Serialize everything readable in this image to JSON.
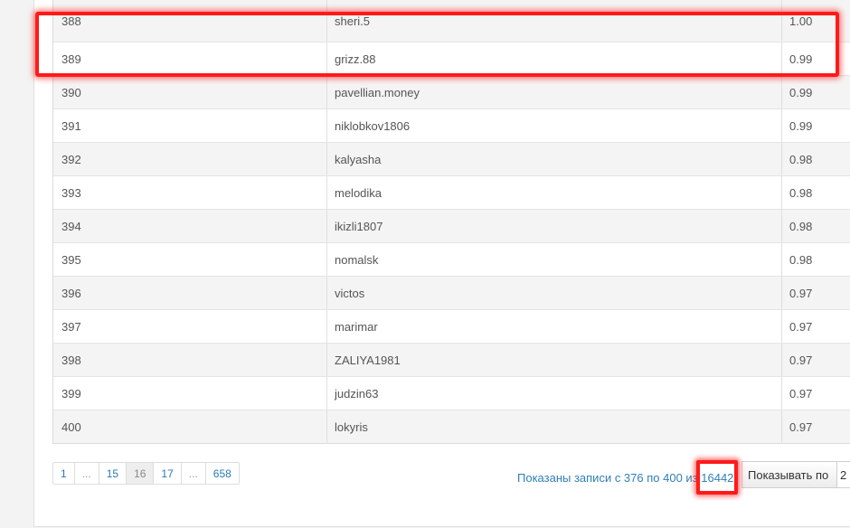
{
  "table": {
    "rows": [
      {
        "num": "388",
        "name": "sheri.5",
        "value": "1.00"
      },
      {
        "num": "389",
        "name": "grizz.88",
        "value": "0.99"
      },
      {
        "num": "390",
        "name": "pavellian.money",
        "value": "0.99"
      },
      {
        "num": "391",
        "name": "niklobkov1806",
        "value": "0.99"
      },
      {
        "num": "392",
        "name": "kalyasha",
        "value": "0.98"
      },
      {
        "num": "393",
        "name": "melodika",
        "value": "0.98"
      },
      {
        "num": "394",
        "name": "ikizli1807",
        "value": "0.98"
      },
      {
        "num": "395",
        "name": "nomalsk",
        "value": "0.98"
      },
      {
        "num": "396",
        "name": "victos",
        "value": "0.97"
      },
      {
        "num": "397",
        "name": "marimar",
        "value": "0.97"
      },
      {
        "num": "398",
        "name": "ZALIYA1981",
        "value": "0.97"
      },
      {
        "num": "399",
        "name": "judzin63",
        "value": "0.97"
      },
      {
        "num": "400",
        "name": "lokyris",
        "value": "0.97"
      }
    ]
  },
  "pagination": {
    "items": [
      {
        "label": "1",
        "state": "link"
      },
      {
        "label": "...",
        "state": "ellipsis"
      },
      {
        "label": "15",
        "state": "link"
      },
      {
        "label": "16",
        "state": "active"
      },
      {
        "label": "17",
        "state": "link"
      },
      {
        "label": "...",
        "state": "ellipsis"
      },
      {
        "label": "658",
        "state": "link"
      }
    ]
  },
  "info": {
    "prefix": "Показаны записи с 376 по 400 из ",
    "total": "16442"
  },
  "per_page": {
    "label": "Показывать по",
    "value": "2"
  },
  "colors": {
    "link": "#2a7ab3",
    "highlight": "#ff1a1a",
    "row_stripe": "#f4f4f4"
  }
}
